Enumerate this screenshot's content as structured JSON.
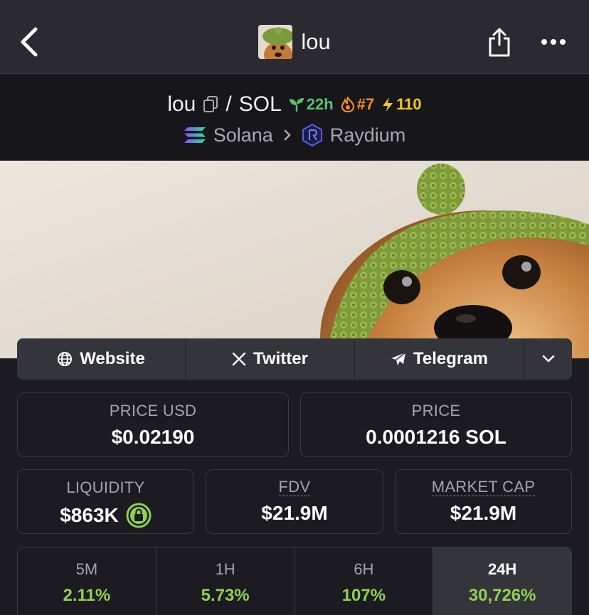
{
  "nav": {
    "title": "lou"
  },
  "pair": {
    "base": "lou",
    "slash": "/",
    "quote": "SOL",
    "age_badge": "22h",
    "rank_badge": "#7",
    "boost_badge": "110",
    "chain": "Solana",
    "dex": "Raydium"
  },
  "links": {
    "website": "Website",
    "twitter": "Twitter",
    "telegram": "Telegram"
  },
  "stats": {
    "price_usd": {
      "label": "PRICE USD",
      "value": "$0.02190"
    },
    "price_native": {
      "label": "PRICE",
      "value": "0.0001216 SOL"
    },
    "liquidity": {
      "label": "LIQUIDITY",
      "value": "$863K"
    },
    "fdv": {
      "label": "FDV",
      "value": "$21.9M"
    },
    "market_cap": {
      "label": "MARKET CAP",
      "value": "$21.9M"
    }
  },
  "changes": [
    {
      "label": "5M",
      "value": "2.11%"
    },
    {
      "label": "1H",
      "value": "5.73%"
    },
    {
      "label": "6H",
      "value": "107%"
    },
    {
      "label": "24H",
      "value": "30,726%"
    }
  ],
  "colors": {
    "positive": "#8fd14f",
    "lock": "#8fd14f",
    "age": "#5cc06b",
    "rank": "#f28c28",
    "boost": "#f5c518"
  }
}
